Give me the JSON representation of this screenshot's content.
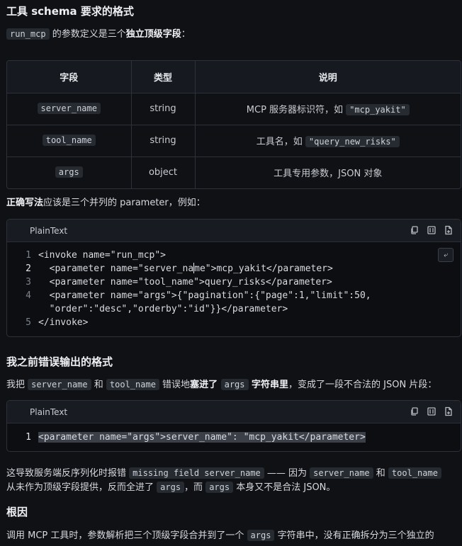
{
  "section1": {
    "title": "工具 schema 要求的格式",
    "intro_code": "run_mcp",
    "intro_text_pre": " 的参数定义是三个",
    "intro_strong": "独立顶级字段",
    "intro_text_post": "："
  },
  "table": {
    "headers": [
      "字段",
      "类型",
      "说明"
    ],
    "rows": [
      {
        "field": "server_name",
        "type": "string",
        "desc_pre": "MCP 服务器标识符，如 ",
        "desc_code": "\"mcp_yakit\""
      },
      {
        "field": "tool_name",
        "type": "string",
        "desc_pre": "工具名，如 ",
        "desc_code": "\"query_new_risks\""
      },
      {
        "field": "args",
        "type": "object",
        "desc_pre": "工具专用参数，JSON 对象",
        "desc_code": ""
      }
    ]
  },
  "correct": {
    "strong": "正确写法",
    "text": "应该是三个并列的 parameter，例如："
  },
  "codeblock1": {
    "language": "PlainText",
    "wrap_label": "⤶",
    "lines": [
      {
        "n": "1",
        "text": "<invoke name=\"run_mcp\">"
      },
      {
        "n": "2",
        "text_a": "  <parameter name=\"server_na",
        "text_b": "me\">mcp_yakit</parameter>"
      },
      {
        "n": "3",
        "text": "  <parameter name=\"tool_name\">query_risks</parameter>"
      },
      {
        "n": "4",
        "text": "  <parameter name=\"args\">{\"pagination\":{\"page\":1,\"limit\":50,"
      },
      {
        "n": "",
        "text": "  \"order\":\"desc\",\"orderby\":\"id\"}}</parameter>"
      },
      {
        "n": "5",
        "text": "</invoke>"
      }
    ]
  },
  "section2": {
    "title": "我之前错误输出的格式",
    "p1": "我把 ",
    "c1": "server_name",
    "p2": " 和 ",
    "c2": "tool_name",
    "p3": " 错误地",
    "s1": "塞进了 ",
    "c3": "args",
    "s2": " 字符串里",
    "p4": "，变成了一段不合法的 JSON 片段："
  },
  "codeblock2": {
    "language": "PlainText",
    "lines": [
      {
        "n": "1",
        "text": "<parameter name=\"args\">server_name\": \"mcp_yakit</parameter>"
      }
    ]
  },
  "consequence": {
    "l1_a": "这导致服务端反序列化时报错 ",
    "l1_c1": "missing field server_name",
    "l1_b": " —— 因为 ",
    "l1_c2": "server_name",
    "l1_c": " 和 ",
    "l1_c3": "tool_name",
    "l2_a": "从未作为顶级字段提供，反而全进了 ",
    "l2_c1": "args",
    "l2_b": "，而 ",
    "l2_c2": "args",
    "l2_c": " 本身又不是合法 JSON。"
  },
  "section3": {
    "title": "根因",
    "l1_a": "调用 MCP 工具时，参数解析把三个顶级字段合并到了一个 ",
    "l1_c": "args",
    "l1_b": " 字符串中，没有正确拆分为三个独立的"
  }
}
